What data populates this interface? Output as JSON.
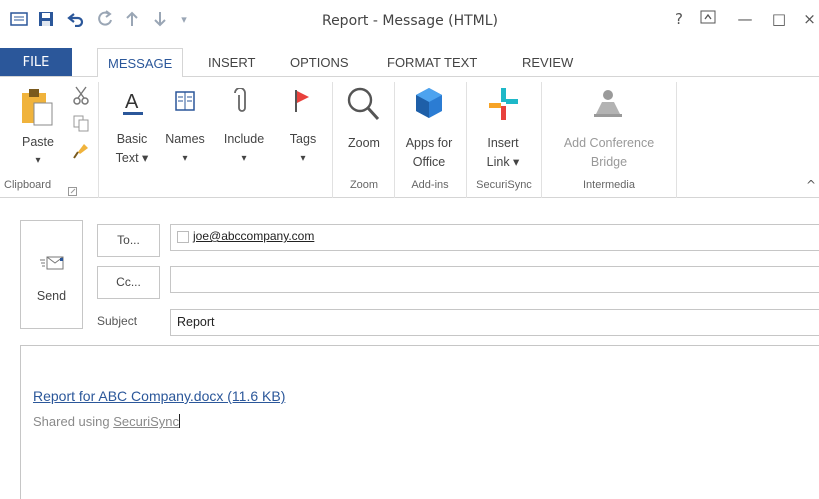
{
  "window": {
    "title": "Report - Message (HTML)",
    "help": "?",
    "minimize": "—",
    "restore": "□",
    "close": "×"
  },
  "tabs": [
    "FILE",
    "MESSAGE",
    "INSERT",
    "OPTIONS",
    "FORMAT TEXT",
    "REVIEW"
  ],
  "ribbon": {
    "clipboard": {
      "paste": "Paste",
      "paste_arrow": "▾",
      "group": "Clipboard"
    },
    "basic_text": {
      "line1": "Basic",
      "line2": "Text ▾"
    },
    "names": {
      "line1": "Names",
      "line2": "▾"
    },
    "include": {
      "line1": "Include",
      "line2": "▾"
    },
    "tags": {
      "line1": "Tags",
      "line2": "▾"
    },
    "zoom": {
      "label": "Zoom",
      "group": "Zoom"
    },
    "apps": {
      "line1": "Apps for",
      "line2": "Office",
      "group": "Add-ins"
    },
    "insert_link": {
      "line1": "Insert",
      "line2": "Link ▾",
      "group": "SecuriSync"
    },
    "conference": {
      "line1": "Add Conference",
      "line2": "Bridge",
      "group": "Intermedia"
    },
    "collapse": "^"
  },
  "compose": {
    "send": "Send",
    "to_button": "To...",
    "cc_button": "Cc...",
    "to_value": "joe@abccompany.com",
    "cc_value": "",
    "subject_label": "Subject",
    "subject_value": "Report",
    "attachment_link": "Report for ABC Company.docx (11.6 KB)",
    "shared_prefix": "Shared using ",
    "shared_link": "SecuriSync"
  },
  "colors": {
    "accent": "#2b579a",
    "link": "#2b579a",
    "securisync_red": "#e8413c",
    "securisync_teal": "#1eb8c8",
    "securisync_orange": "#f7a326"
  }
}
